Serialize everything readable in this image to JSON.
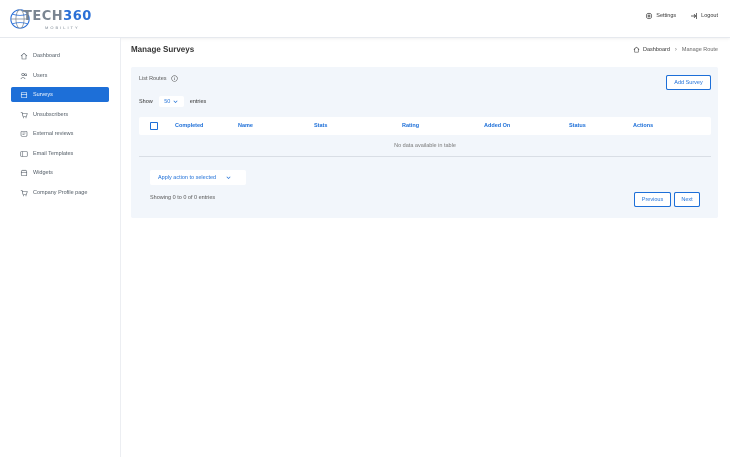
{
  "header": {
    "logo_main": "TECH",
    "logo_accent": "360",
    "logo_sub": "MOBILITY",
    "settings_label": "Settings",
    "logout_label": "Logout"
  },
  "sidebar": {
    "items": [
      {
        "label": "Dashboard",
        "icon": "home-icon",
        "active": false
      },
      {
        "label": "Users",
        "icon": "users-icon",
        "active": false
      },
      {
        "label": "Surveys",
        "icon": "survey-icon",
        "active": true
      },
      {
        "label": "Unsubscribers",
        "icon": "cart-icon",
        "active": false
      },
      {
        "label": "External reviews",
        "icon": "review-icon",
        "active": false
      },
      {
        "label": "Email Templates",
        "icon": "template-icon",
        "active": false
      },
      {
        "label": "Widgets",
        "icon": "widget-icon",
        "active": false
      },
      {
        "label": "Company Profile page",
        "icon": "cart-icon",
        "active": false
      }
    ]
  },
  "main": {
    "title": "Manage Surveys",
    "breadcrumb": {
      "home": "Dashboard",
      "current": "Manage Route"
    },
    "list_label": "List Routes",
    "add_button": "Add Survey",
    "show_label": "Show",
    "entries_value": "50",
    "entries_label": "entries",
    "columns": [
      "Completed",
      "Name",
      "Stats",
      "Rating",
      "Added On",
      "Status",
      "Actions"
    ],
    "empty_text": "No data available in table",
    "apply_action": "Apply action to selected",
    "showing_text": "Showing 0 to 0 of 0 entries",
    "prev_label": "Previous",
    "next_label": "Next"
  },
  "colors": {
    "accent": "#1d6fd8",
    "panel_bg": "#f2f6fb"
  }
}
